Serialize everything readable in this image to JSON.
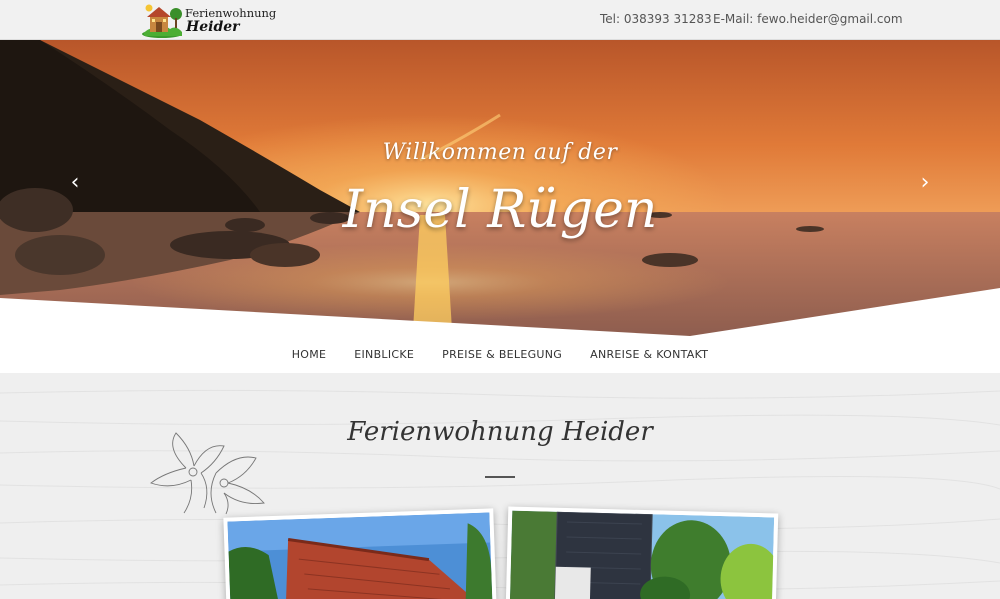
{
  "header": {
    "logo": {
      "line1": "Ferienwohnung",
      "line2": "Heider"
    },
    "phone": "Tel: 038393 31283",
    "email": "E-Mail: fewo.heider@gmail.com"
  },
  "hero": {
    "subtitle": "Willkommen auf der",
    "title": "Insel Rügen",
    "prev_icon": "chevron-left-icon",
    "next_icon": "chevron-right-icon"
  },
  "nav": {
    "items": [
      {
        "label": "HOME"
      },
      {
        "label": "EINBLICKE"
      },
      {
        "label": "PREISE & BELEGUNG"
      },
      {
        "label": "ANREISE & KONTAKT"
      }
    ]
  },
  "main": {
    "title": "Ferienwohnung Heider"
  },
  "colors": {
    "sunset_orange": "#e8893a",
    "topbar_bg": "#f1f1f1",
    "content_bg": "#f0f0f0"
  }
}
